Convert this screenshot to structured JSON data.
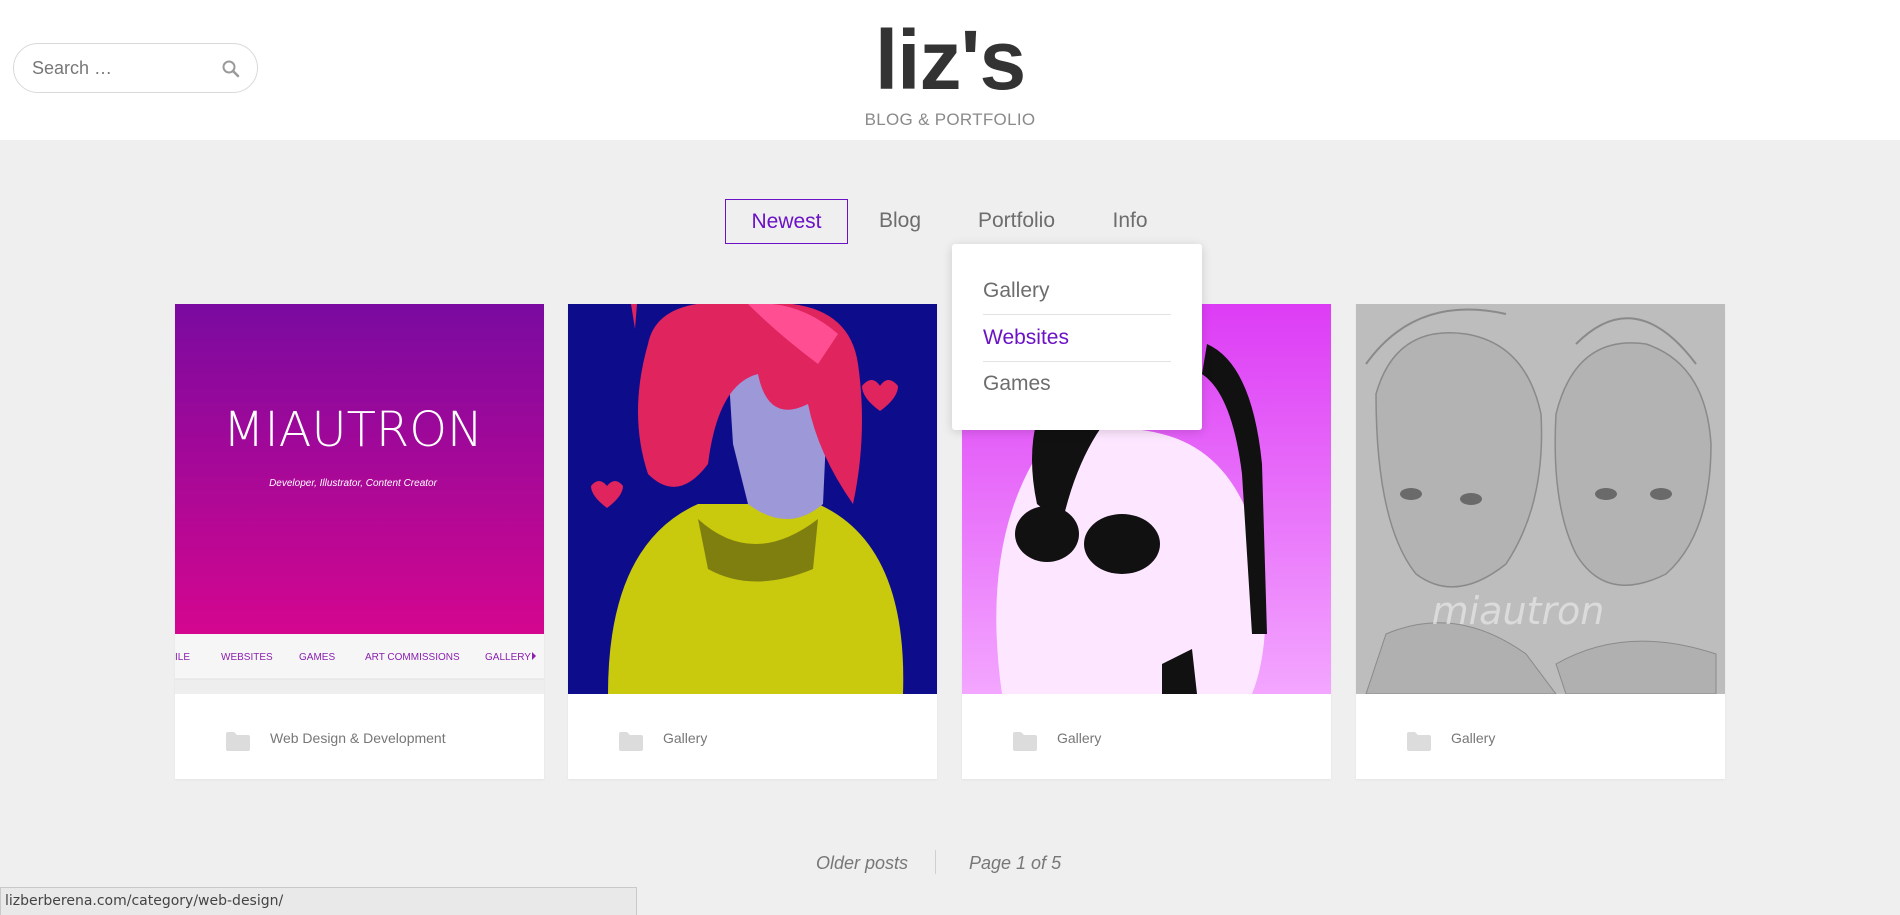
{
  "header": {
    "site_title": "liz's",
    "tagline": "BLOG & PORTFOLIO",
    "search_placeholder": "Search …",
    "search_icon": "search-icon"
  },
  "nav": {
    "items": [
      {
        "label": "Newest",
        "active": true
      },
      {
        "label": "Blog",
        "active": false
      },
      {
        "label": "Portfolio",
        "active": false
      },
      {
        "label": "Info",
        "active": false
      }
    ],
    "dropdown": [
      {
        "label": "Gallery",
        "highlighted": false
      },
      {
        "label": "Websites",
        "highlighted": true
      },
      {
        "label": "Games",
        "highlighted": false
      }
    ]
  },
  "posts": [
    {
      "category": "Web Design & Development",
      "thumb": {
        "logo_text": "MIAUTRON",
        "logo_subtitle": "Developer, Illustrator, Content Creator",
        "menu": [
          "ILE",
          "WEBSITES",
          "GAMES",
          "ART COMMISSIONS",
          "GALLERY"
        ]
      }
    },
    {
      "category": "Gallery"
    },
    {
      "category": "Gallery"
    },
    {
      "category": "Gallery",
      "thumb": {
        "watermark": "miautron"
      }
    }
  ],
  "pagination": {
    "older_label": "Older posts",
    "page_info": "Page 1 of 5"
  },
  "status_bar": {
    "url": "lizberberena.com/category/web-design/"
  },
  "colors": {
    "accent": "#6b12c6",
    "background": "#efefef",
    "text": "#6d6d6d"
  }
}
